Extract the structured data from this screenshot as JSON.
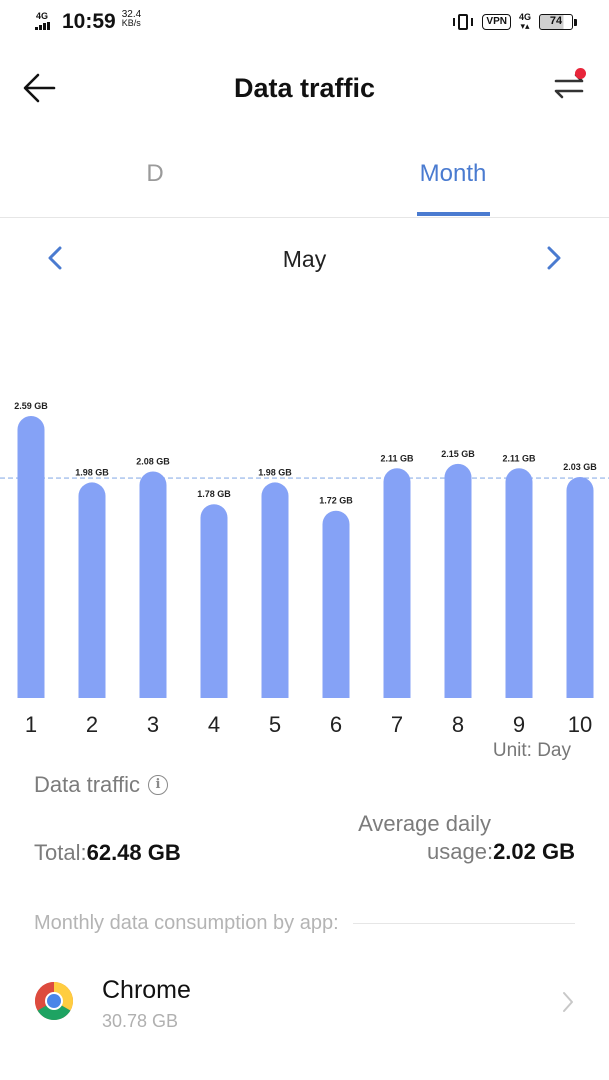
{
  "status_bar": {
    "network_left": "4G",
    "time": "10:59",
    "speed_value": "32.4",
    "speed_unit": "KB/s",
    "vpn": "VPN",
    "network_right": "4G",
    "battery": "74"
  },
  "header": {
    "title": "Data traffic",
    "has_notification_dot": true
  },
  "tabs": [
    {
      "label": "D",
      "selected": false
    },
    {
      "label": "Month",
      "selected": true
    }
  ],
  "month_nav": {
    "month": "May"
  },
  "chart_data": {
    "type": "bar",
    "categories": [
      "1",
      "2",
      "3",
      "4",
      "5",
      "6",
      "7",
      "8",
      "9",
      "10"
    ],
    "values": [
      2.59,
      1.98,
      2.08,
      1.78,
      1.98,
      1.72,
      2.11,
      2.15,
      2.11,
      2.03
    ],
    "value_labels": [
      "2.59 GB",
      "1.98 GB",
      "2.08 GB",
      "1.78 GB",
      "1.98 GB",
      "1.72 GB",
      "2.11 GB",
      "2.15 GB",
      "2.11 GB",
      "2.03 GB"
    ],
    "average_line": 2.02,
    "ylim": [
      0,
      2.59
    ],
    "bar_color": "#85a2f6",
    "average_line_color": "#8fb0e8",
    "unit_label": "Unit: Day"
  },
  "stats": {
    "section_title": "Data traffic",
    "total_label": "Total:",
    "total_value": "62.48 GB",
    "avg_label_line1": "Average daily",
    "avg_label_line2": "usage:",
    "avg_value": "2.02 GB"
  },
  "apps": {
    "header": "Monthly data consumption by app:",
    "items": [
      {
        "name": "Chrome",
        "usage": "30.78 GB",
        "icon": "chrome-icon"
      }
    ]
  },
  "colors": {
    "accent": "#4a7bd0",
    "notification": "#e8253a"
  }
}
